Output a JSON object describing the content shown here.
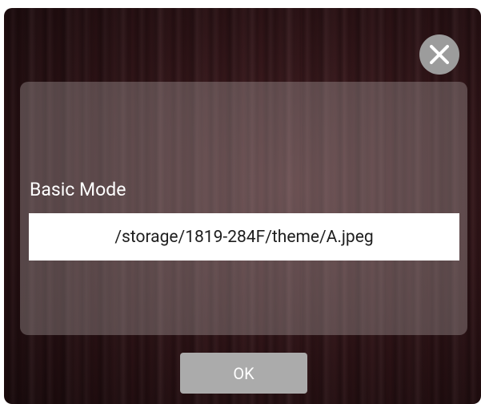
{
  "dialog": {
    "close_icon": "close-x-icon",
    "mode_label": "Basic Mode",
    "file_path": "/storage/1819-284F/theme/A.jpeg",
    "ok_label": "OK"
  },
  "colors": {
    "background": "#2e1316",
    "close_button": "#9c9c9c",
    "ok_button": "#ababab",
    "path_box": "#ffffff"
  }
}
